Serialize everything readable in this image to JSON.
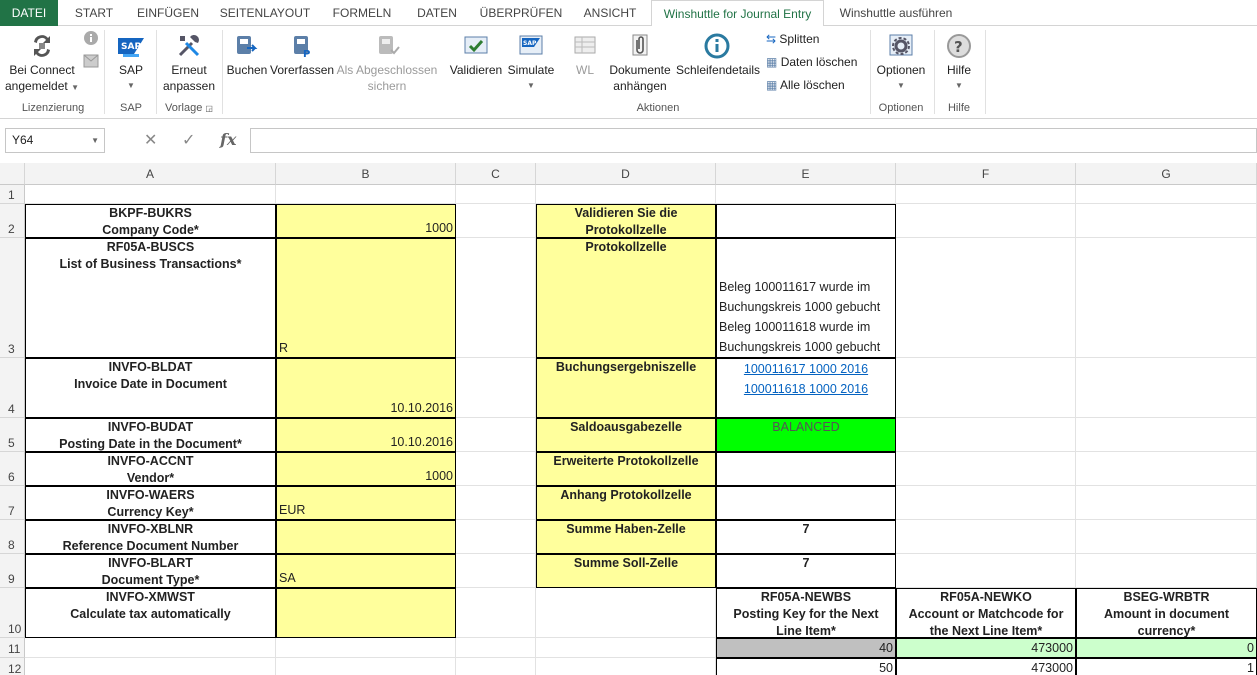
{
  "tabs": [
    "DATEI",
    "START",
    "EINFÜGEN",
    "SEITENLAYOUT",
    "FORMELN",
    "DATEN",
    "ÜBERPRÜFEN",
    "ANSICHT",
    "Winshuttle for Journal Entry",
    "Winshuttle ausführen"
  ],
  "ribbon": {
    "connect": [
      "Bei Connect",
      "angemeldet"
    ],
    "sap": "SAP",
    "renew": [
      "Erneut",
      "anpassen"
    ],
    "post": "Buchen",
    "park": "Vorerfassen",
    "save_done": [
      "Als Abgeschlossen",
      "sichern"
    ],
    "validate": "Validieren",
    "simulate": "Simulate",
    "wl": "WL",
    "attach": [
      "Dokumente",
      "anhängen"
    ],
    "loop": "Schleifendetails",
    "split": "Splitten",
    "clear_data": "Daten löschen",
    "clear_all": "Alle löschen",
    "options": "Optionen",
    "help": "Hilfe",
    "groups": {
      "lic": "Lizenzierung",
      "sap": "SAP",
      "tmpl": "Vorlage",
      "actions": "Aktionen",
      "opts": "Optionen",
      "help": "Hilfe"
    }
  },
  "namebox": "Y64",
  "columns": [
    "A",
    "B",
    "C",
    "D",
    "E",
    "F",
    "G"
  ],
  "rows": [
    "1",
    "2",
    "3",
    "4",
    "5",
    "6",
    "7",
    "8",
    "9",
    "10",
    "11",
    "12"
  ],
  "fields": [
    {
      "l1": "BKPF-BUKRS",
      "l2": "Company Code*",
      "v": "1000"
    },
    {
      "l1": "RF05A-BUSCS",
      "l2": "List of Business Transactions*",
      "v": "R"
    },
    {
      "l1": "INVFO-BLDAT",
      "l2": "Invoice Date in Document",
      "v": "10.10.2016"
    },
    {
      "l1": "INVFO-BUDAT",
      "l2": "Posting Date in the Document*",
      "v": "10.10.2016"
    },
    {
      "l1": "INVFO-ACCNT",
      "l2": "Vendor*",
      "v": "1000"
    },
    {
      "l1": "INVFO-WAERS",
      "l2": "Currency Key*",
      "v": "EUR"
    },
    {
      "l1": "INVFO-XBLNR",
      "l2": "Reference Document Number",
      "v": ""
    },
    {
      "l1": "INVFO-BLART",
      "l2": "Document Type*",
      "v": "SA"
    },
    {
      "l1": "INVFO-XMWST",
      "l2": "Calculate tax automatically",
      "v": ""
    }
  ],
  "control": {
    "validate": [
      "Validieren Sie die",
      "Protokollzelle"
    ],
    "log": "Protokollzelle",
    "log_lines": [
      "Beleg 100011617 wurde im",
      "Buchungskreis 1000 gebucht",
      "Beleg 100011618 wurde im",
      "Buchungskreis 1000 gebucht"
    ],
    "result": "Buchungsergebniszelle",
    "result_links": [
      "100011617 1000 2016",
      "100011618 1000 2016"
    ],
    "balance": "Saldoausgabezelle",
    "balance_val": "BALANCED",
    "ext_log": "Erweiterte Protokollzelle",
    "att_log": "Anhang Protokollzelle",
    "credit": "Summe Haben-Zelle",
    "credit_val": "7",
    "debit": "Summe Soll-Zelle",
    "debit_val": "7"
  },
  "line_headers": [
    {
      "l1": "RF05A-NEWBS",
      "l2": "Posting Key for the Next",
      "l3": "Line Item*"
    },
    {
      "l1": "RF05A-NEWKO",
      "l2": "Account or Matchcode for",
      "l3": "the Next Line Item*"
    },
    {
      "l1": "BSEG-WRBTR",
      "l2": "Amount in document",
      "l3": "currency*"
    }
  ],
  "line_rows": [
    [
      "40",
      "473000",
      "0"
    ],
    [
      "50",
      "473000",
      "1"
    ]
  ],
  "colors": {
    "excel_green": "#217346",
    "yellow": "#ffff9c",
    "balanced": "#00ff00",
    "light_green": "#ccffcc",
    "gray": "#c0c0c0"
  }
}
